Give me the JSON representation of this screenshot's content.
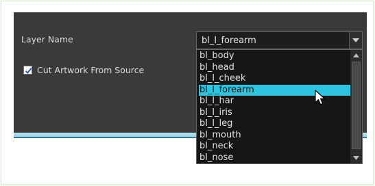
{
  "dialog": {
    "layer_name_label": "Layer Name",
    "layer_name_value": "bl_l_forearm",
    "cut_artwork_label": "Cut Artwork From Source",
    "cut_artwork_checked": true
  },
  "dropdown": {
    "options": [
      "bl_body",
      "bl_head",
      "bl_l_cheek",
      "bl_l_forearm",
      "bl_l_har",
      "bl_l_iris",
      "bl_l_leg",
      "bl_mouth",
      "bl_neck",
      "bl_nose"
    ],
    "selected": "bl_l_forearm"
  },
  "icons": {
    "combo_arrow": "chevron-down-icon",
    "scroll_up": "scroll-up-arrow-icon",
    "scroll_down": "scroll-down-arrow-icon",
    "checkbox": "checkmark-icon",
    "pointer": "mouse-cursor-icon"
  },
  "colors": {
    "dialog_background": "#3a3a3a",
    "selection_highlight": "#2ec4e0",
    "list_background": "#161616",
    "bottom_bar": "#8ccfe6"
  }
}
